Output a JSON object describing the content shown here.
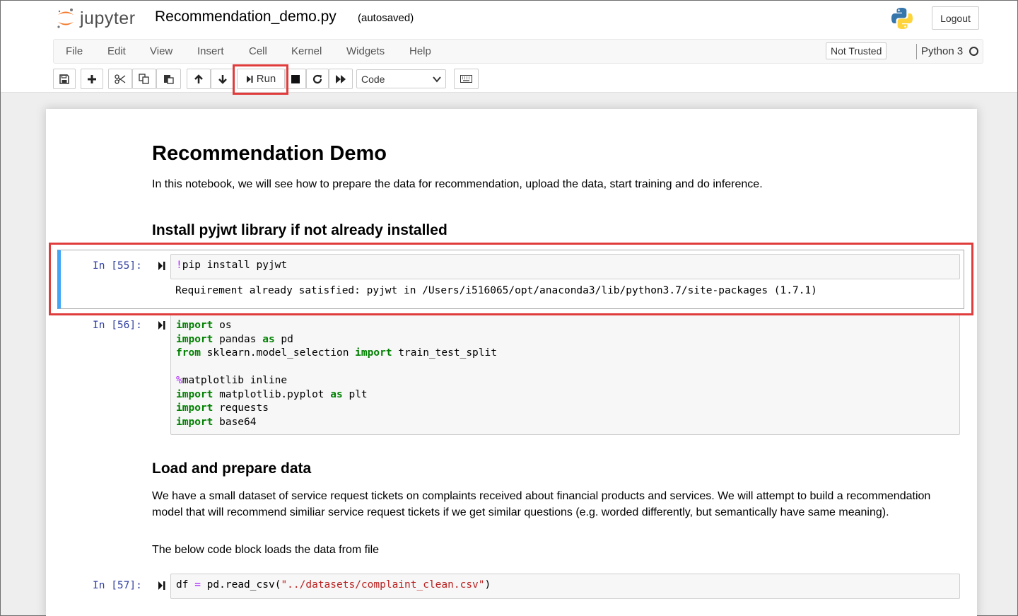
{
  "header": {
    "logo_text": "jupyter",
    "notebook_name": "Recommendation_demo.py",
    "autosave_status": "(autosaved)",
    "logout_label": "Logout"
  },
  "menubar": {
    "items": [
      "File",
      "Edit",
      "View",
      "Insert",
      "Cell",
      "Kernel",
      "Widgets",
      "Help"
    ],
    "trust_status": "Not Trusted",
    "kernel_name": "Python 3"
  },
  "toolbar": {
    "run_label": "Run",
    "cell_type": "Code",
    "icons": [
      "save-icon",
      "plus-icon",
      "cut-icon",
      "copy-icon",
      "paste-icon",
      "arrow-up-icon",
      "arrow-down-icon",
      "run-icon",
      "stop-icon",
      "restart-icon",
      "fast-forward-icon",
      "keyboard-icon"
    ]
  },
  "notebook": {
    "title": "Recommendation Demo",
    "intro": "In this notebook, we will see how to prepare the data for recommendation, upload the data, start training and do inference.",
    "section1_heading": "Install pyjwt library if not already installed",
    "cell55": {
      "prompt": "In [55]:",
      "code_magic": "!",
      "code_text": "pip install pyjwt",
      "output": "Requirement already satisfied: pyjwt in /Users/i516065/opt/anaconda3/lib/python3.7/site-packages (1.7.1)"
    },
    "cell56": {
      "prompt": "In [56]:",
      "lines": [
        {
          "kw1": "import",
          "t1": " os"
        },
        {
          "kw1": "import",
          "t1": " pandas ",
          "kw2": "as",
          "t2": " pd"
        },
        {
          "kw1": "from",
          "t1": " sklearn.model_selection ",
          "kw2": "import",
          "t2": " train_test_split"
        },
        {
          "mg": "%",
          "t1": "matplotlib inline"
        },
        {
          "kw1": "import",
          "t1": " matplotlib.pyplot ",
          "kw2": "as",
          "t2": " plt"
        },
        {
          "kw1": "import",
          "t1": " requests"
        },
        {
          "kw1": "import",
          "t1": " base64"
        }
      ]
    },
    "section2_heading": "Load and prepare data",
    "para1": "We have a small dataset of service request tickets on complaints received about financial products and services. We will attempt to build a recommendation model that will recommend similiar service request tickets if we get similar questions (e.g. worded differently, but semantically have same meaning).",
    "para2": "The below code block loads the data from file",
    "cell57": {
      "prompt": "In [57]:",
      "t1": "df ",
      "op": "=",
      "t2": " pd.read_csv(",
      "str": "\"../datasets/complaint_clean.csv\"",
      "t3": ")"
    }
  },
  "colors": {
    "highlight": "#e03c3c",
    "selected_cell_bar": "#42a5f5",
    "prompt": "#303f9f",
    "keyword": "#008000",
    "magic": "#aa22ff",
    "string": "#ba2121"
  }
}
